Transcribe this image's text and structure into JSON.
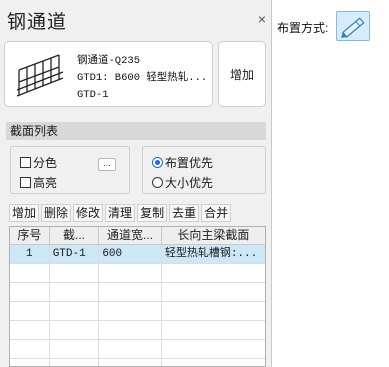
{
  "panel": {
    "title": "钢通道",
    "close_glyph": "×"
  },
  "preview": {
    "lines": [
      "钢通道-Q235",
      "GTD1: B600 轻型热轧...",
      "GTD-1"
    ],
    "add_label": "增加"
  },
  "section": {
    "title": "截面列表"
  },
  "options": {
    "color_split": "分色",
    "highlight": "高亮",
    "ellipsis": "...",
    "layout_priority": "布置优先",
    "size_priority": "大小优先",
    "selected": "布置优先"
  },
  "toolbar": {
    "buttons": [
      "增加",
      "删除",
      "修改",
      "清理",
      "复制",
      "去重",
      "合并"
    ]
  },
  "table": {
    "headers": [
      "序号",
      "截...",
      "通道宽...",
      "长向主梁截面"
    ],
    "rows": [
      {
        "no": "1",
        "section": "GTD-1",
        "width": "600",
        "beam": "轻型热轧槽钢:..."
      }
    ]
  },
  "layout_mode": {
    "label": "布置方式:",
    "icon": "pencil-icon"
  },
  "colors": {
    "selected_row": "#cce8f6",
    "accent": "#1e6fd0"
  }
}
